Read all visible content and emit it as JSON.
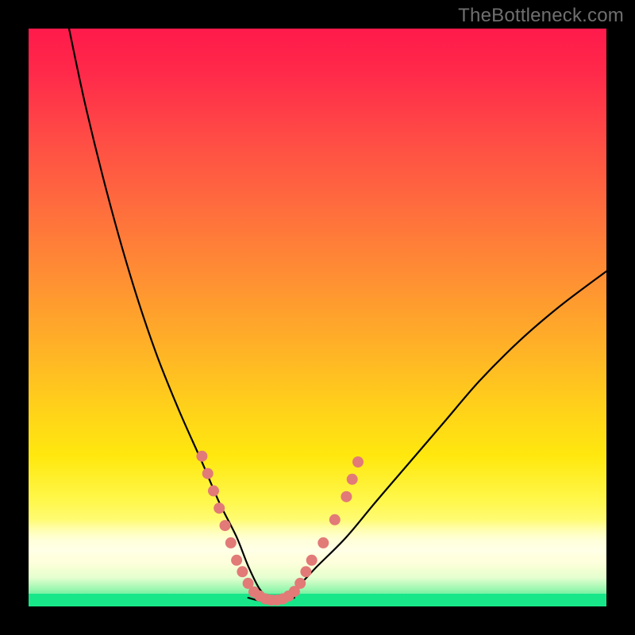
{
  "watermark": "TheBottleneck.com",
  "chart_data": {
    "type": "line",
    "title": "",
    "xlabel": "",
    "ylabel": "",
    "xlim": [
      0,
      100
    ],
    "ylim": [
      0,
      100
    ],
    "grid": false,
    "notes": "V-shaped bottleneck curve over a vertical rainbow gradient (red top → green bottom). Minimum of curve sits at the green band. Salmon dots mark sample points along both legs near the trough.",
    "series": [
      {
        "name": "curve-left",
        "x": [
          7,
          10,
          14,
          18,
          22,
          26,
          30,
          33,
          36,
          38,
          40,
          42
        ],
        "y": [
          100,
          86,
          70,
          56,
          44,
          34,
          25,
          18,
          12,
          7,
          3,
          1
        ]
      },
      {
        "name": "curve-right",
        "x": [
          42,
          46,
          50,
          55,
          60,
          66,
          72,
          78,
          85,
          92,
          100
        ],
        "y": [
          1,
          3,
          7,
          12,
          18,
          25,
          32,
          39,
          46,
          52,
          58
        ]
      },
      {
        "name": "trough-flat",
        "x": [
          38,
          40,
          42,
          44,
          46
        ],
        "y": [
          1.5,
          1,
          1,
          1,
          1.5
        ]
      }
    ],
    "dots": {
      "name": "sample-points",
      "color": "#e27a78",
      "points": [
        {
          "x": 30,
          "y": 26
        },
        {
          "x": 31,
          "y": 23
        },
        {
          "x": 32,
          "y": 20
        },
        {
          "x": 33,
          "y": 17
        },
        {
          "x": 34,
          "y": 14
        },
        {
          "x": 35,
          "y": 11
        },
        {
          "x": 36,
          "y": 8
        },
        {
          "x": 37,
          "y": 6
        },
        {
          "x": 38,
          "y": 4
        },
        {
          "x": 39,
          "y": 2.5
        },
        {
          "x": 40,
          "y": 1.8
        },
        {
          "x": 41,
          "y": 1.3
        },
        {
          "x": 42,
          "y": 1.1
        },
        {
          "x": 43,
          "y": 1.1
        },
        {
          "x": 44,
          "y": 1.3
        },
        {
          "x": 45,
          "y": 1.8
        },
        {
          "x": 46,
          "y": 2.6
        },
        {
          "x": 47,
          "y": 4
        },
        {
          "x": 48,
          "y": 6
        },
        {
          "x": 49,
          "y": 8
        },
        {
          "x": 51,
          "y": 11
        },
        {
          "x": 53,
          "y": 15
        },
        {
          "x": 55,
          "y": 19
        },
        {
          "x": 56,
          "y": 22
        },
        {
          "x": 57,
          "y": 25
        }
      ]
    },
    "gradient_stops": [
      {
        "pos": 0,
        "color": "#ff1a4b"
      },
      {
        "pos": 18,
        "color": "#ff4946"
      },
      {
        "pos": 42,
        "color": "#ff8c34"
      },
      {
        "pos": 66,
        "color": "#ffd21a"
      },
      {
        "pos": 88,
        "color": "#ffff98"
      },
      {
        "pos": 97,
        "color": "#9cf7b0"
      },
      {
        "pos": 100,
        "color": "#18e789"
      }
    ]
  }
}
